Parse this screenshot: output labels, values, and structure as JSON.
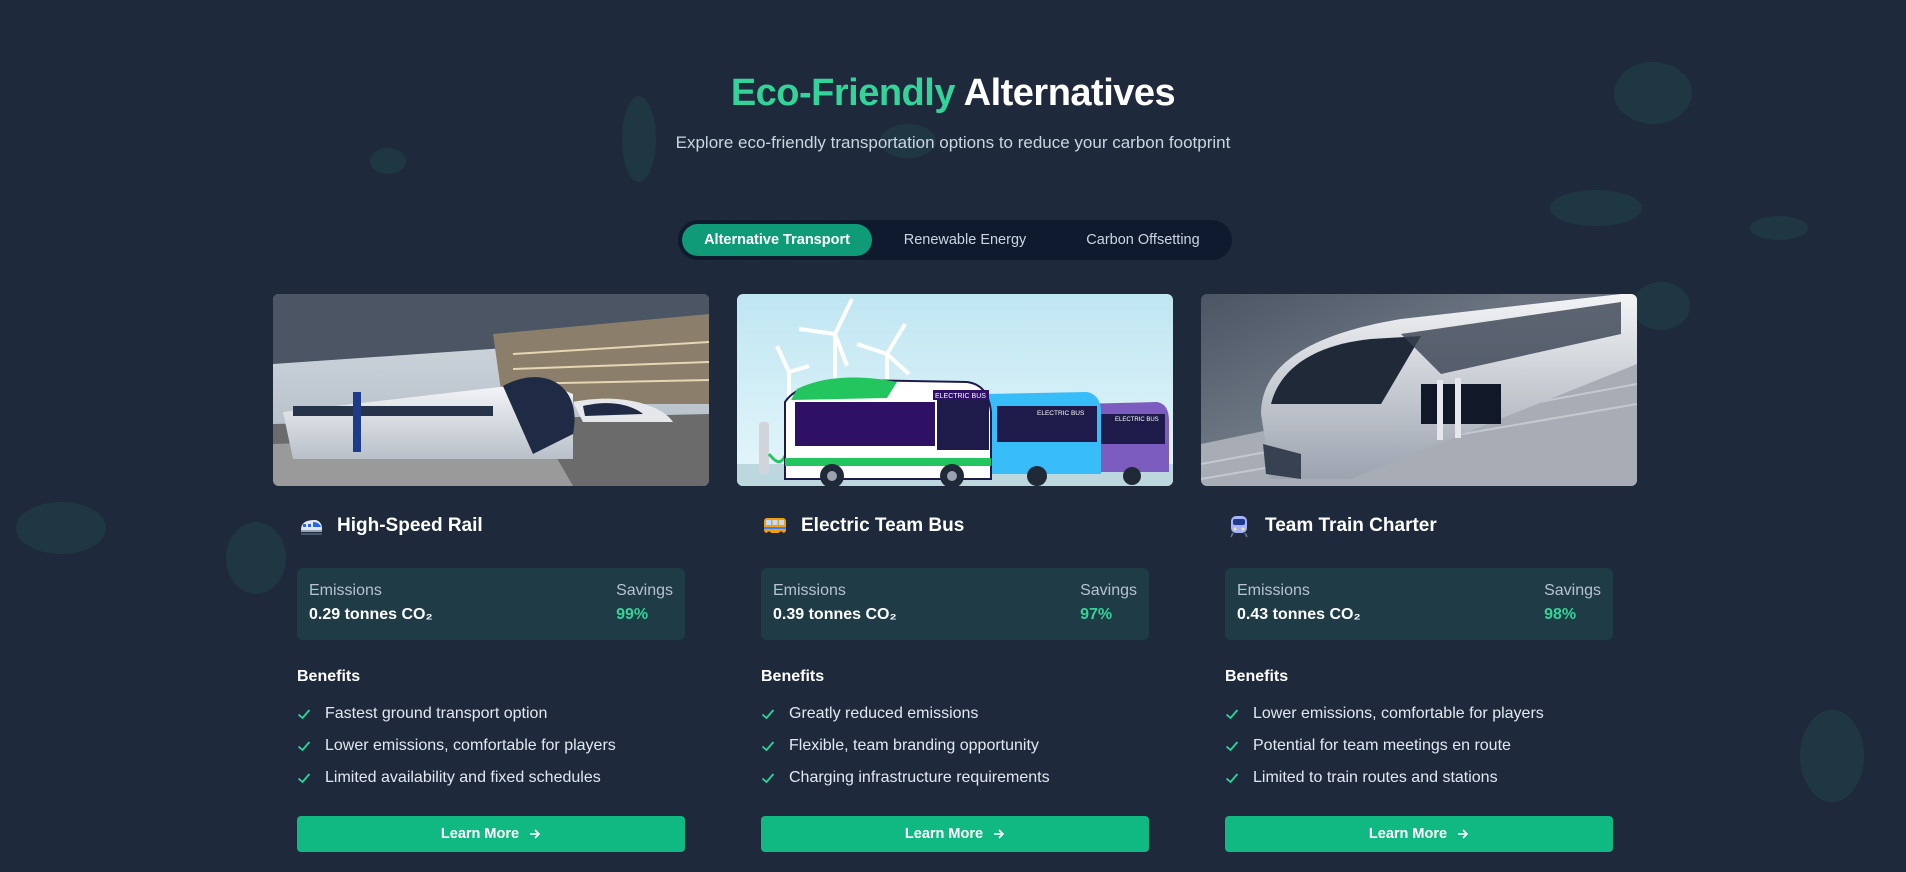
{
  "header": {
    "title_accent": "Eco-Friendly",
    "title_rest": "Alternatives",
    "subtitle": "Explore eco-friendly transportation options to reduce your carbon footprint"
  },
  "tabs": [
    {
      "label": "Alternative Transport",
      "active": true
    },
    {
      "label": "Renewable Energy",
      "active": false
    },
    {
      "label": "Carbon Offsetting",
      "active": false
    }
  ],
  "colors": {
    "background": "#1e293b",
    "accent": "#34d399",
    "button": "#10b981",
    "active_tab": "#0f9b77"
  },
  "cards": [
    {
      "icon": "high-speed-train-icon",
      "title": "High-Speed Rail",
      "image": "high-speed-train-photo",
      "emissions_label": "Emissions",
      "emissions_value": "0.29 tonnes CO₂",
      "savings_label": "Savings",
      "savings_value": "99%",
      "benefits_title": "Benefits",
      "benefits": [
        "Fastest ground transport option",
        "Lower emissions, comfortable for players",
        "Limited availability and fixed schedules"
      ],
      "button_label": "Learn More"
    },
    {
      "icon": "bus-icon",
      "title": "Electric Team Bus",
      "image": "electric-buses-illustration",
      "image_text": "ELECTRIC BUS",
      "emissions_label": "Emissions",
      "emissions_value": "0.39 tonnes CO₂",
      "savings_label": "Savings",
      "savings_value": "97%",
      "benefits_title": "Benefits",
      "benefits": [
        "Greatly reduced emissions",
        "Flexible, team branding opportunity",
        "Charging infrastructure requirements"
      ],
      "button_label": "Learn More"
    },
    {
      "icon": "train-icon",
      "title": "Team Train Charter",
      "image": "futuristic-train-render",
      "emissions_label": "Emissions",
      "emissions_value": "0.43 tonnes CO₂",
      "savings_label": "Savings",
      "savings_value": "98%",
      "benefits_title": "Benefits",
      "benefits": [
        "Lower emissions, comfortable for players",
        "Potential for team meetings en route",
        "Limited to train routes and stations"
      ],
      "button_label": "Learn More"
    }
  ]
}
